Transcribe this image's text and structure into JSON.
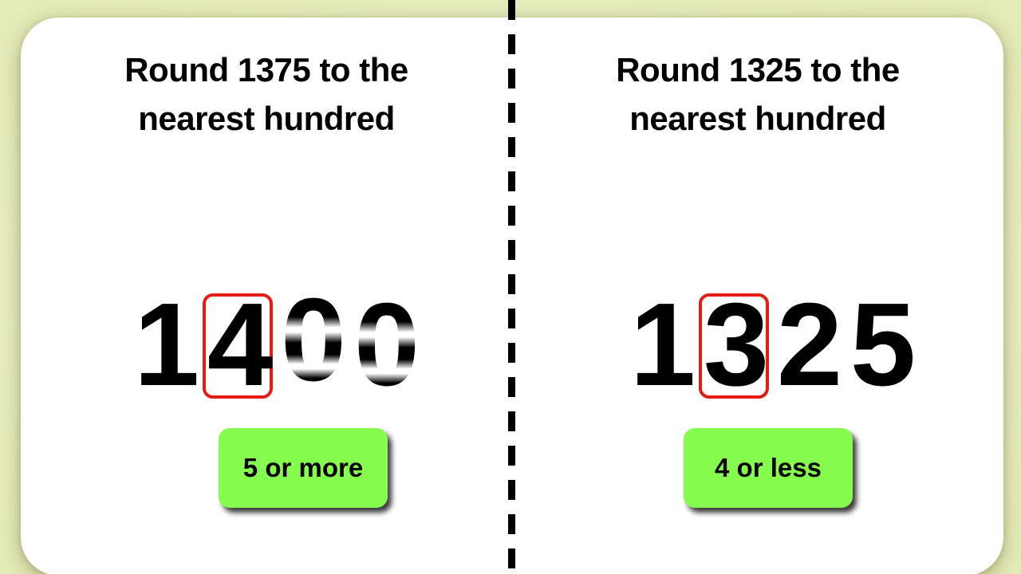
{
  "theme": {
    "background_color": "#e6edbd",
    "card_color": "#ffffff",
    "highlight_box_color": "#e51b14",
    "pill_color": "#85fc4e",
    "digit_color": "#000000",
    "divider_color": "#000000"
  },
  "panels": {
    "left": {
      "title": "Round 1375 to the nearest hundred",
      "digits": [
        {
          "value": "1",
          "boxed": false,
          "flipping": false
        },
        {
          "value": "4",
          "boxed": true,
          "flipping": false
        },
        {
          "value": "0",
          "boxed": false,
          "flipping": true
        },
        {
          "value": "0",
          "boxed": false,
          "flipping": true
        }
      ],
      "pill_label": "5 or more"
    },
    "right": {
      "title": "Round 1325 to the nearest hundred",
      "digits": [
        {
          "value": "1",
          "boxed": false,
          "flipping": false
        },
        {
          "value": "3",
          "boxed": true,
          "flipping": false
        },
        {
          "value": "2",
          "boxed": false,
          "flipping": false
        },
        {
          "value": "5",
          "boxed": false,
          "flipping": false
        }
      ],
      "pill_label": "4 or less"
    }
  }
}
